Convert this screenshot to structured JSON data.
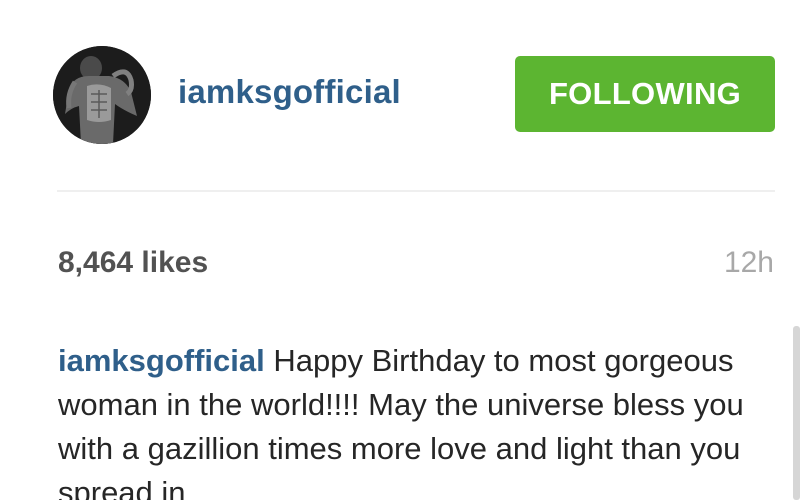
{
  "post": {
    "header": {
      "avatar_icon": "profile-photo",
      "username": "iamksgofficial",
      "follow_button_label": "FOLLOWING"
    },
    "likes": "8,464 likes",
    "timestamp": "12h",
    "caption": {
      "username": "iamksgofficial",
      "text": "Happy Birthday to most gorgeous woman in the world!!!! May the universe bless you with a gazillion times more love and light than you spread in"
    }
  },
  "colors": {
    "username_blue": "#2f5f8a",
    "follow_green": "#5cb531",
    "likes_gray": "#525252",
    "timestamp_gray": "#a8a8a8",
    "divider": "#efefef"
  }
}
